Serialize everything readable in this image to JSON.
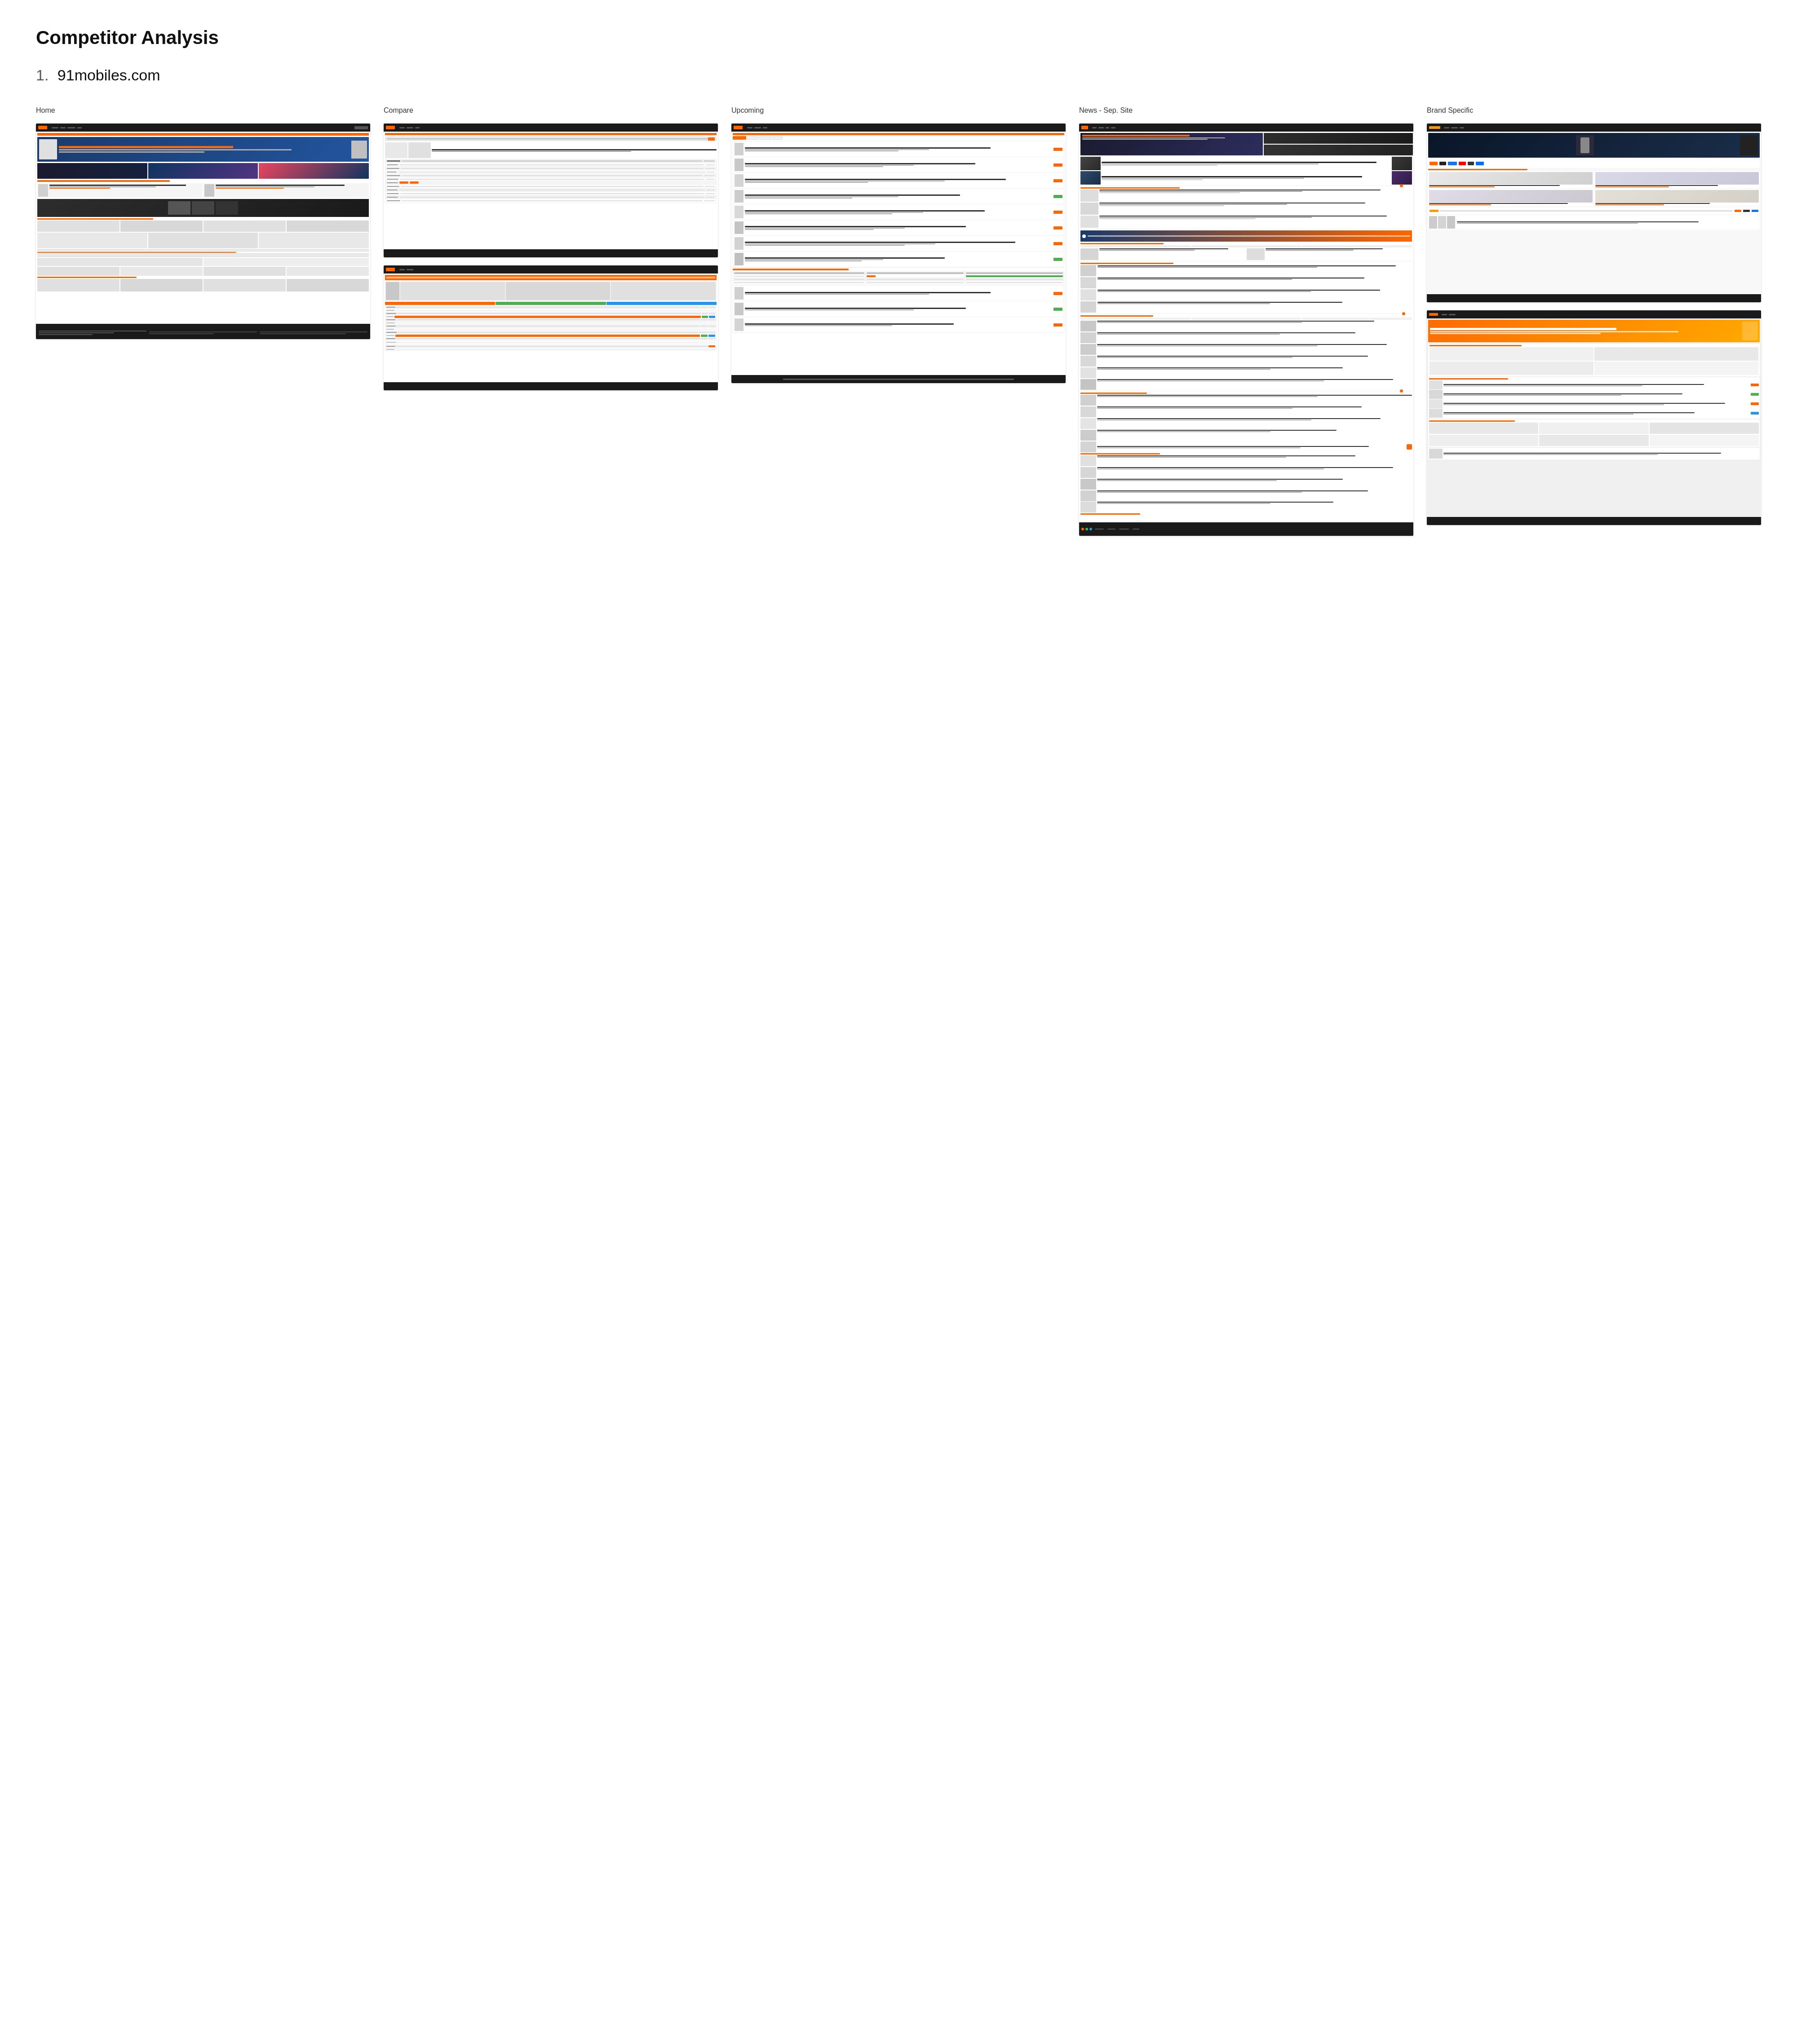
{
  "page": {
    "title": "Competitor Analysis",
    "sections": [
      {
        "number": "1.",
        "name": "91mobiles.com",
        "columns": [
          {
            "id": "home",
            "label": "Home",
            "screenshots": [
              {
                "id": "home-main",
                "type": "home",
                "tall": true
              }
            ]
          },
          {
            "id": "compare",
            "label": "Compare",
            "screenshots": [
              {
                "id": "compare-1",
                "type": "compare-top"
              },
              {
                "id": "compare-2",
                "type": "compare-bottom"
              }
            ]
          },
          {
            "id": "upcoming",
            "label": "Upcoming",
            "screenshots": [
              {
                "id": "upcoming-main",
                "type": "upcoming"
              }
            ]
          },
          {
            "id": "news",
            "label": "News - Sep. Site",
            "screenshots": [
              {
                "id": "news-main",
                "type": "news"
              }
            ]
          },
          {
            "id": "brand",
            "label": "Brand Specific",
            "screenshots": [
              {
                "id": "brand-1",
                "type": "brand-top"
              },
              {
                "id": "brand-2",
                "type": "brand-bottom"
              }
            ]
          }
        ]
      }
    ]
  }
}
